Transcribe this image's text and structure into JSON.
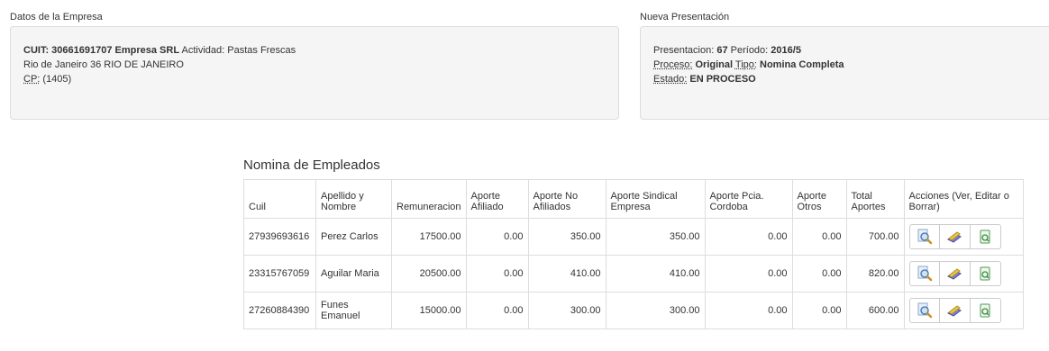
{
  "empresa": {
    "title": "Datos de la Empresa",
    "cuit_label": "CUIT:",
    "cuit_value": "30661691707",
    "company": "Empresa SRL",
    "actividad_label": "Actividad:",
    "actividad_value": "Pastas Frescas",
    "address": "Rio de Janeiro 36 RIO DE JANEIRO",
    "cp_label": "CP:",
    "cp_value": "(1405)"
  },
  "presentacion": {
    "title": "Nueva Presentación",
    "presentacion_label": "Presentacion:",
    "presentacion_value": "67",
    "periodo_label": "Período:",
    "periodo_value": "2016/5",
    "proceso_label": "Proceso:",
    "proceso_value": "Original",
    "tipo_label": "Tipo:",
    "tipo_value": "Nomina Completa",
    "estado_label": "Estado:",
    "estado_value": "EN PROCESO"
  },
  "nomina": {
    "title": "Nomina de Empleados",
    "headers": [
      "Cuil",
      "Apellido y Nombre",
      "Remuneracion",
      "Aporte Afiliado",
      "Aporte No Afiliados",
      "Aporte Sindical Empresa",
      "Aporte Pcia. Cordoba",
      "Aporte Otros",
      "Total Aportes",
      "Acciones (Ver, Editar o Borrar)"
    ],
    "rows": [
      [
        "27939693616",
        "Perez Carlos",
        "17500.00",
        "0.00",
        "350.00",
        "350.00",
        "0.00",
        "0.00",
        "700.00"
      ],
      [
        "23315767059",
        "Aguilar Maria",
        "20500.00",
        "0.00",
        "410.00",
        "410.00",
        "0.00",
        "0.00",
        "820.00"
      ],
      [
        "27260884390",
        "Funes Emanuel",
        "15000.00",
        "0.00",
        "300.00",
        "300.00",
        "0.00",
        "0.00",
        "600.00"
      ]
    ],
    "actions": [
      "view-icon",
      "edit-icon",
      "delete-icon"
    ]
  }
}
